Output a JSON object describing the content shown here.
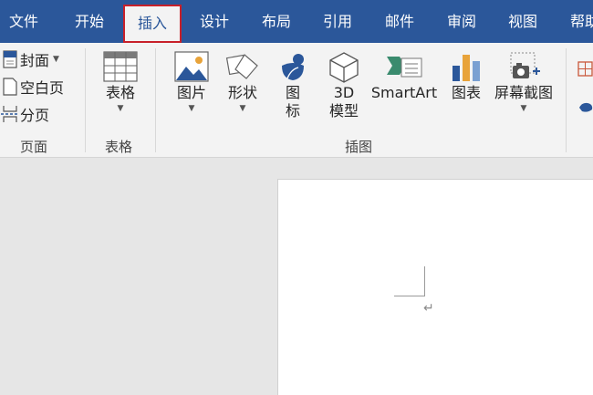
{
  "tabs": {
    "file": "文件",
    "home": "开始",
    "insert": "插入",
    "design": "设计",
    "layout": "布局",
    "references": "引用",
    "mailings": "邮件",
    "review": "审阅",
    "view": "视图",
    "help": "帮助"
  },
  "pages_group": {
    "cover": "封面",
    "blank": "空白页",
    "page_break": "分页",
    "label": "页面"
  },
  "tables_group": {
    "table": "表格",
    "label": "表格"
  },
  "illustrations_group": {
    "picture": "图片",
    "shapes": "形状",
    "icons_line1": "图",
    "icons_line2": "标",
    "model_line1": "3D",
    "model_line2": "模型",
    "smartart": "SmartArt",
    "chart": "图表",
    "screenshot": "屏幕截图",
    "label": "插图"
  },
  "document": {
    "paragraph_mark": "↵"
  },
  "colors": {
    "tab_bar": "#2b579a",
    "ribbon": "#f3f3f3",
    "active_tab_border": "#c8202a",
    "workspace": "#e6e6e6"
  }
}
